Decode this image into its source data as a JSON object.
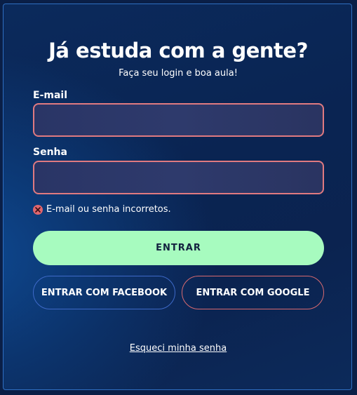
{
  "login": {
    "title": "Já estuda com a gente?",
    "subtitle": "Faça seu login e boa aula!",
    "email_label": "E-mail",
    "email_value": "",
    "password_label": "Senha",
    "password_value": "",
    "error_message": "E-mail ou senha incorretos.",
    "submit_label": "ENTRAR",
    "facebook_label": "ENTRAR COM FACEBOOK",
    "google_label": "ENTRAR COM GOOGLE",
    "forgot_label": "Esqueci minha senha"
  },
  "colors": {
    "background": "#0b2a5c",
    "card_border": "#2f6fc2",
    "input_error_border": "#e07a80",
    "primary_button": "#a7fbbf",
    "error_icon": "#e0666e",
    "facebook_border": "#3e6ac9",
    "google_border": "#d86a70"
  },
  "icons": {
    "error": "error-circle-x-icon"
  }
}
